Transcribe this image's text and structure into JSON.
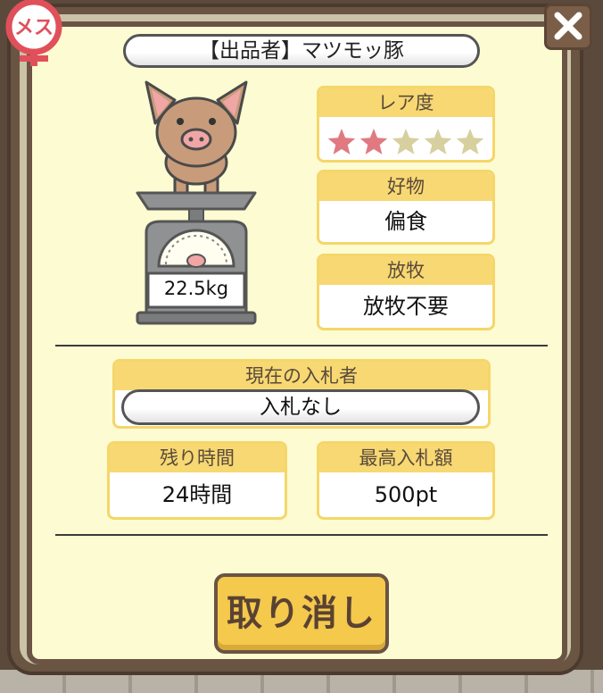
{
  "seller": {
    "label": "【出品者】マツモッ豚"
  },
  "gender_badge": {
    "text": "メス",
    "icon": "female-symbol-icon",
    "color": "#e0505a"
  },
  "pig": {
    "weight": "22.5kg"
  },
  "rarity": {
    "label": "レア度",
    "filled": 2,
    "total": 5,
    "filled_color": "#e07a80",
    "empty_color": "#d8cf9e"
  },
  "favorite": {
    "label": "好物",
    "value": "偏食"
  },
  "grazing": {
    "label": "放牧",
    "value": "放牧不要"
  },
  "current_bidder": {
    "label": "現在の入札者",
    "value": "入札なし"
  },
  "time_left": {
    "label": "残り時間",
    "value": "24時間"
  },
  "max_bid": {
    "label": "最高入札額",
    "value": "500pt"
  },
  "cancel_button": {
    "label": "取り消し"
  },
  "close_button": {
    "icon": "close-icon"
  }
}
